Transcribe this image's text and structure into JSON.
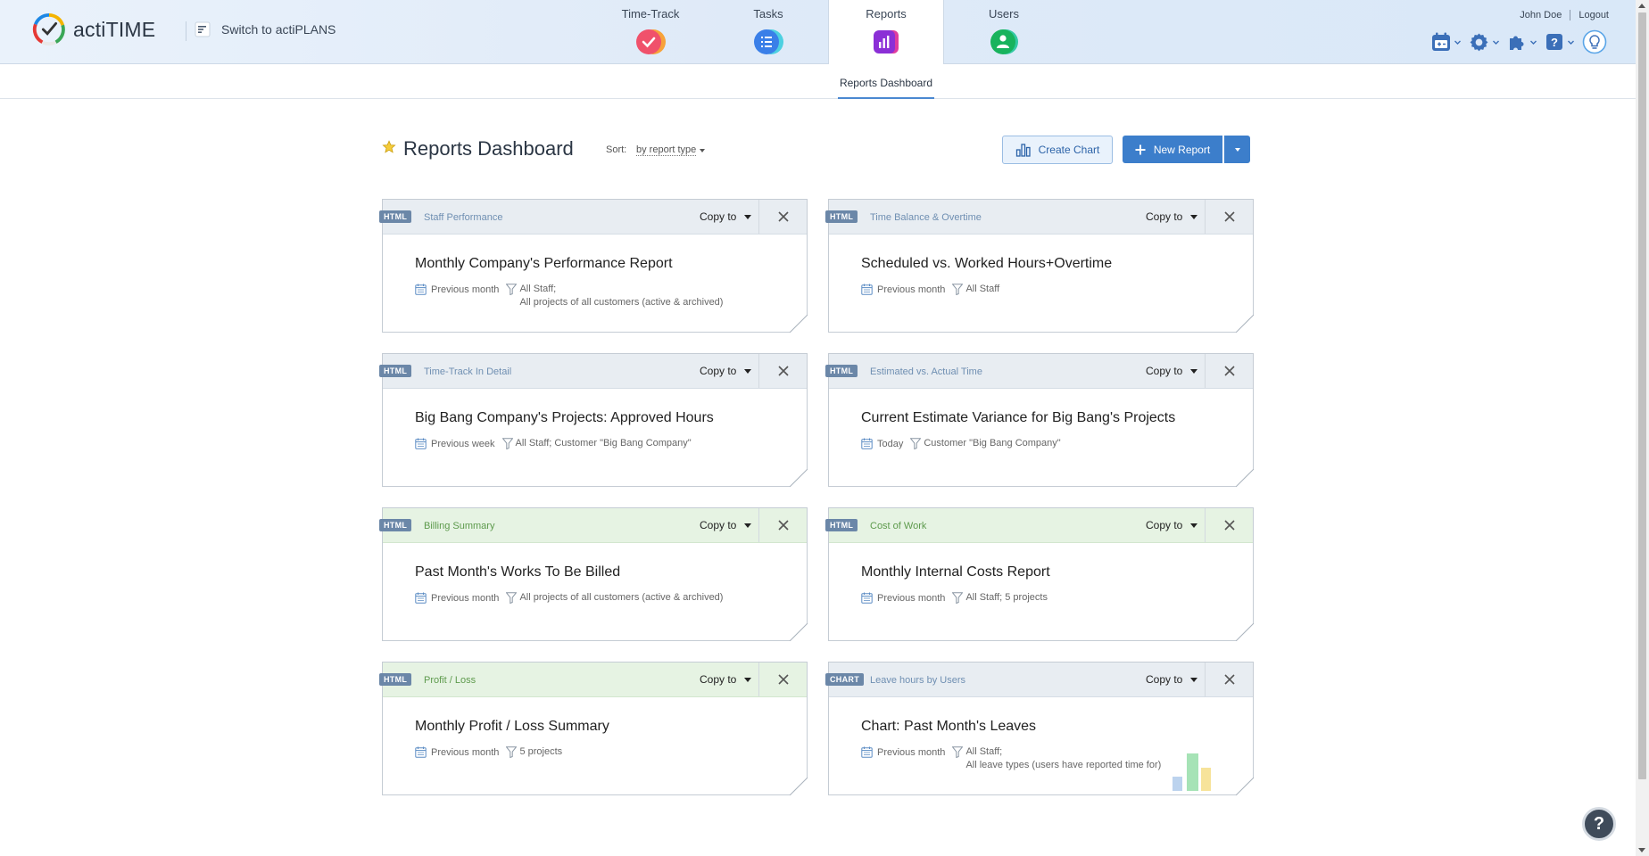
{
  "header": {
    "logo_text": "actiTIME",
    "switch_label": "Switch to actiPLANS",
    "tabs": [
      {
        "label": "Time-Track",
        "icon": "time-track-icon",
        "color": "#f0516b"
      },
      {
        "label": "Tasks",
        "icon": "tasks-icon",
        "color": "#3a8ee8"
      },
      {
        "label": "Reports",
        "icon": "reports-icon",
        "color": "#9b2fd6"
      },
      {
        "label": "Users",
        "icon": "users-icon",
        "color": "#1fbf78"
      }
    ],
    "user_name": "John Doe",
    "logout_label": "Logout",
    "tools": [
      "calendar-icon",
      "settings-icon",
      "addons-icon",
      "help-icon",
      "lightbulb-icon"
    ]
  },
  "subnav": {
    "active_tab": "Reports Dashboard"
  },
  "page": {
    "title": "Reports Dashboard",
    "sort_label": "Sort:",
    "sort_value": "by report type",
    "create_chart_label": "Create Chart",
    "new_report_label": "New Report"
  },
  "cards": [
    {
      "badge": "HTML",
      "type": "Staff Performance",
      "title": "Monthly Company's Performance Report",
      "period": "Previous month",
      "filter": "All Staff;",
      "filter2": "All projects of all customers (active & archived)",
      "copy_label": "Copy to",
      "theme": "blue"
    },
    {
      "badge": "HTML",
      "type": "Time Balance & Overtime",
      "title": "Scheduled vs. Worked Hours+Overtime",
      "period": "Previous month",
      "filter": "All Staff",
      "filter2": "",
      "copy_label": "Copy to",
      "theme": "blue"
    },
    {
      "badge": "HTML",
      "type": "Time-Track In Detail",
      "title": "Big Bang Company's Projects: Approved Hours",
      "period": "Previous week",
      "filter": "All Staff; Customer \"Big Bang Company\"",
      "filter2": "",
      "copy_label": "Copy to",
      "theme": "blue"
    },
    {
      "badge": "HTML",
      "type": "Estimated vs. Actual Time",
      "title": "Current Estimate Variance for Big Bang's Projects",
      "period": "Today",
      "filter": "Customer \"Big Bang Company\"",
      "filter2": "",
      "copy_label": "Copy to",
      "theme": "blue"
    },
    {
      "badge": "HTML",
      "type": "Billing Summary",
      "title": "Past Month's Works To Be Billed",
      "period": "Previous month",
      "filter": "All projects of all customers (active & archived)",
      "filter2": "",
      "copy_label": "Copy to",
      "theme": "green"
    },
    {
      "badge": "HTML",
      "type": "Cost of Work",
      "title": "Monthly Internal Costs Report",
      "period": "Previous month",
      "filter": "All Staff; 5 projects",
      "filter2": "",
      "copy_label": "Copy to",
      "theme": "green"
    },
    {
      "badge": "HTML",
      "type": "Profit / Loss",
      "title": "Monthly Profit / Loss Summary",
      "period": "Previous month",
      "filter": "5 projects",
      "filter2": "",
      "copy_label": "Copy to",
      "theme": "green"
    },
    {
      "badge": "CHART",
      "type": "Leave hours by Users",
      "title": "Chart: Past Month's Leaves",
      "period": "Previous month",
      "filter": "All Staff;",
      "filter2": "All leave types (users have reported time for)",
      "copy_label": "Copy to",
      "theme": "blue"
    }
  ],
  "help_button": "?"
}
